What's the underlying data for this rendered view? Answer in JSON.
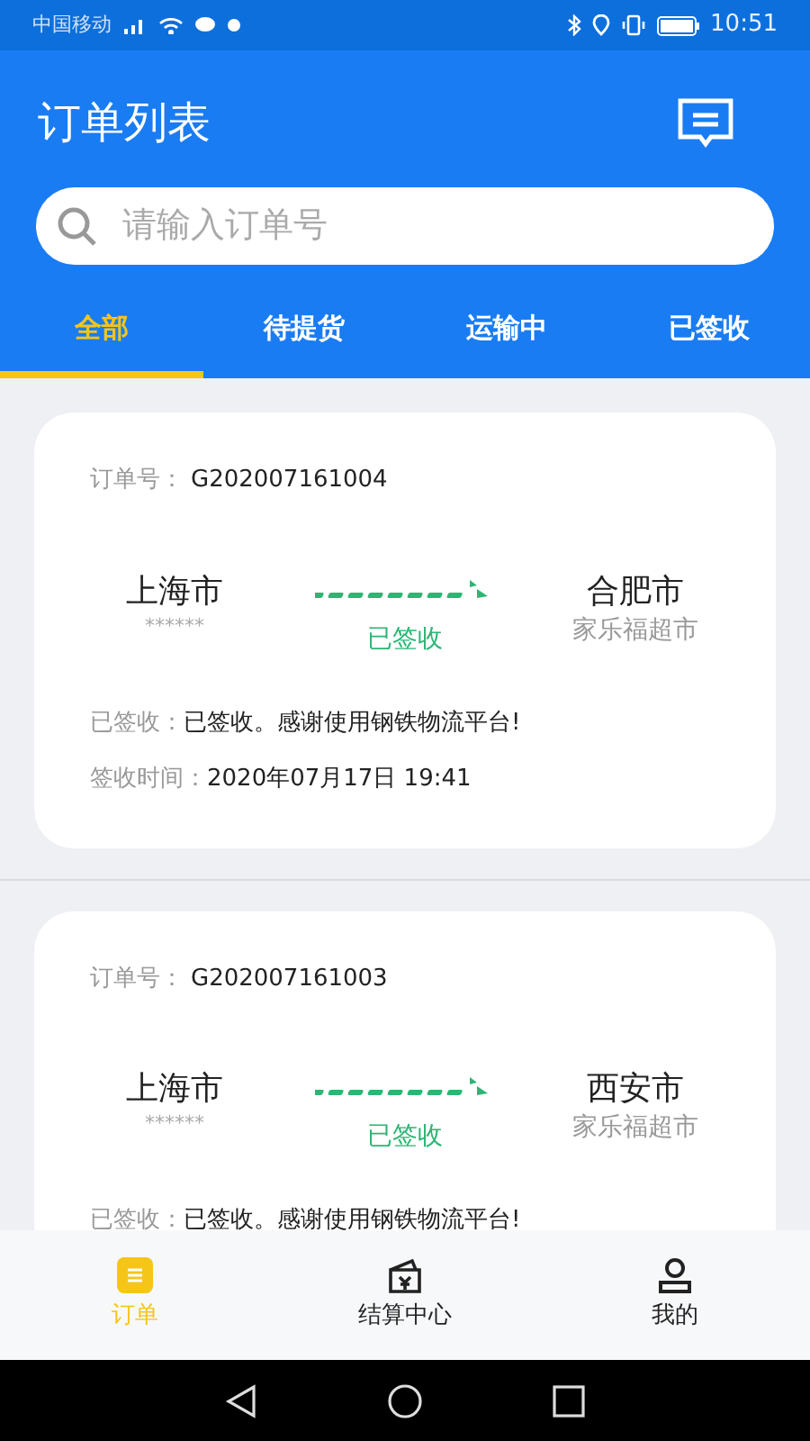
{
  "status_bar": {
    "carrier": "中国移动",
    "time": "10:51"
  },
  "header": {
    "title": "订单列表"
  },
  "search": {
    "placeholder": "请输入订单号"
  },
  "tabs": [
    {
      "label": "全部",
      "selected": true
    },
    {
      "label": "待提货",
      "selected": false
    },
    {
      "label": "运输中",
      "selected": false
    },
    {
      "label": "已签收",
      "selected": false
    }
  ],
  "orders": [
    {
      "order_label": "订单号：",
      "order_no": "G202007161004",
      "from_city": "上海市",
      "from_note": "******",
      "to_city": "合肥市",
      "to_note": "家乐福超市",
      "status": "已签收",
      "message_label": "已签收：",
      "message": "已签收。感谢使用钢铁物流平台!",
      "time_label": "签收时间：",
      "time": "2020年07月17日 19:41"
    },
    {
      "order_label": "订单号：",
      "order_no": "G202007161003",
      "from_city": "上海市",
      "from_note": "******",
      "to_city": "西安市",
      "to_note": "家乐福超市",
      "status": "已签收",
      "message_label": "已签收：",
      "message": "已签收。感谢使用钢铁物流平台!"
    }
  ],
  "bottom_nav": [
    {
      "label": "订单",
      "kind": "orders",
      "selected": true
    },
    {
      "label": "结算中心",
      "kind": "wallet",
      "selected": false
    },
    {
      "label": "我的",
      "kind": "profile",
      "selected": false
    }
  ]
}
